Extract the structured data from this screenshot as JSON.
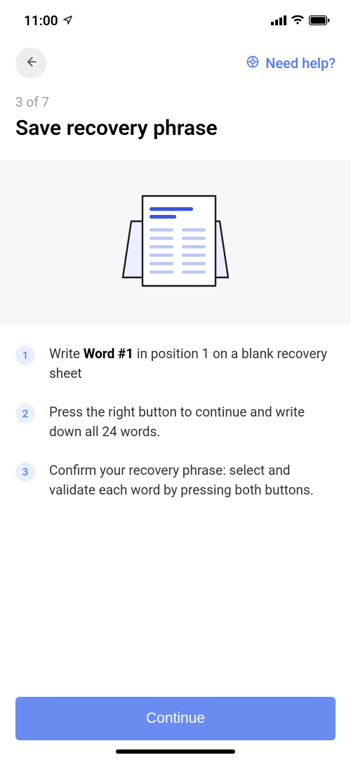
{
  "statusBar": {
    "time": "11:00"
  },
  "header": {
    "helpLabel": "Need help?"
  },
  "title": {
    "stepOf": "3 of 7",
    "heading": "Save recovery phrase"
  },
  "steps": [
    {
      "num": "1",
      "prefix": "Write ",
      "bold": "Word #1",
      "suffix": " in position 1 on a blank recovery sheet"
    },
    {
      "num": "2",
      "prefix": "Press the right button to continue and write down all 24 words.",
      "bold": "",
      "suffix": ""
    },
    {
      "num": "3",
      "prefix": "Confirm your recovery phrase: select and validate each word by pressing both buttons.",
      "bold": "",
      "suffix": ""
    }
  ],
  "footer": {
    "continueLabel": "Continue"
  }
}
